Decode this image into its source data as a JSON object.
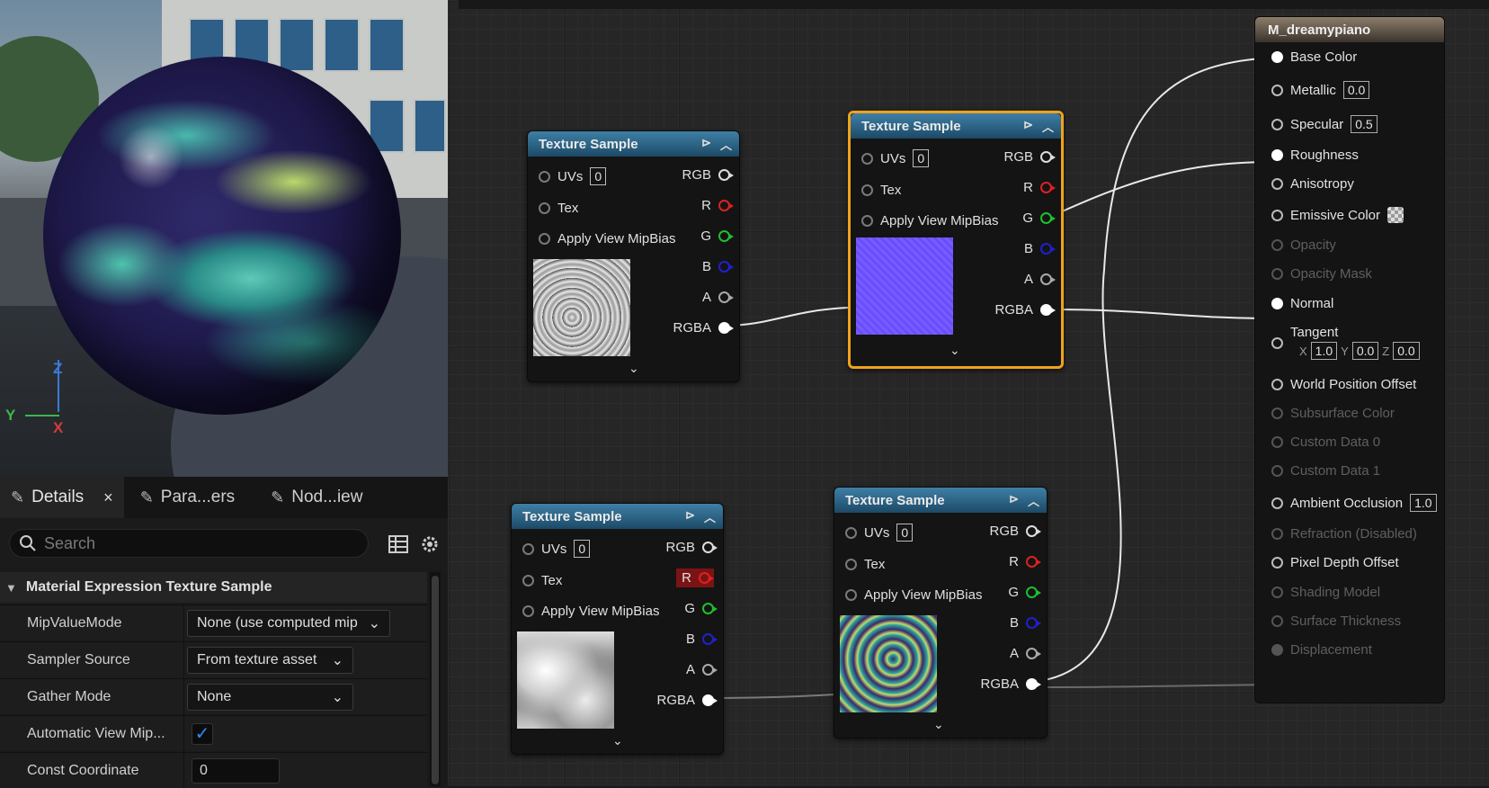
{
  "viewport": {
    "axes": {
      "z": "Z",
      "y": "Y",
      "x": "X"
    }
  },
  "details_panel": {
    "tabs": [
      {
        "label": "Details",
        "close": "×"
      },
      {
        "label": "Para...ers"
      },
      {
        "label": "Nod...iew"
      }
    ],
    "search_placeholder": "Search",
    "section_title": "Material Expression Texture Sample",
    "properties": [
      {
        "label": "MipValueMode",
        "value": "None (use computed mip"
      },
      {
        "label": "Sampler Source",
        "value": "From texture asset"
      },
      {
        "label": "Gather Mode",
        "value": "None"
      },
      {
        "label": "Automatic View Mip...",
        "value": "✓"
      },
      {
        "label": "Const Coordinate",
        "value": "0"
      }
    ]
  },
  "texture_node": {
    "title": "Texture Sample",
    "uvs_label": "UVs",
    "uvs_value": "0",
    "tex_label": "Tex",
    "mipbias_label": "Apply View MipBias",
    "outputs": [
      "RGB",
      "R",
      "G",
      "B",
      "A",
      "RGBA"
    ]
  },
  "nodes": [
    {
      "id": "ts1",
      "title": "Texture Sample",
      "selected": false,
      "texture": "grayscale-swirl"
    },
    {
      "id": "ts2",
      "title": "Texture Sample",
      "selected": true,
      "texture": "blue-normal-map"
    },
    {
      "id": "ts3",
      "title": "Texture Sample",
      "selected": false,
      "texture": "gray-cloud"
    },
    {
      "id": "ts4",
      "title": "Texture Sample",
      "selected": false,
      "texture": "teal-purple-swirl"
    }
  ],
  "colors": {
    "accent_selection": "#f0a21a",
    "r_pin": "#e02020",
    "g_pin": "#1fbf2f",
    "b_pin": "#2020d0"
  },
  "material": {
    "title": "M_dreamypiano",
    "inputs": [
      {
        "label": "Base Color",
        "enabled": true
      },
      {
        "label": "Metallic",
        "value": "0.0",
        "enabled": true
      },
      {
        "label": "Specular",
        "value": "0.5",
        "enabled": true
      },
      {
        "label": "Roughness",
        "enabled": true
      },
      {
        "label": "Anisotropy",
        "enabled": true
      },
      {
        "label": "Emissive Color",
        "enabled": true
      },
      {
        "label": "Opacity",
        "enabled": false
      },
      {
        "label": "Opacity Mask",
        "enabled": false
      },
      {
        "label": "Normal",
        "enabled": true
      },
      {
        "label": "Tangent",
        "enabled": true
      },
      {
        "label": "World Position Offset",
        "enabled": true
      },
      {
        "label": "Subsurface Color",
        "enabled": false
      },
      {
        "label": "Custom Data 0",
        "enabled": false
      },
      {
        "label": "Custom Data 1",
        "enabled": false
      },
      {
        "label": "Ambient Occlusion",
        "value": "1.0",
        "enabled": true
      },
      {
        "label": "Refraction (Disabled)",
        "enabled": false
      },
      {
        "label": "Pixel Depth Offset",
        "enabled": true
      },
      {
        "label": "Shading Model",
        "enabled": false
      },
      {
        "label": "Surface Thickness",
        "enabled": false
      },
      {
        "label": "Displacement",
        "enabled": false
      }
    ],
    "tangent": {
      "x_label": "X",
      "x": "1.0",
      "y_label": "Y",
      "y": "0.0",
      "z_label": "Z",
      "z": "0.0"
    }
  }
}
